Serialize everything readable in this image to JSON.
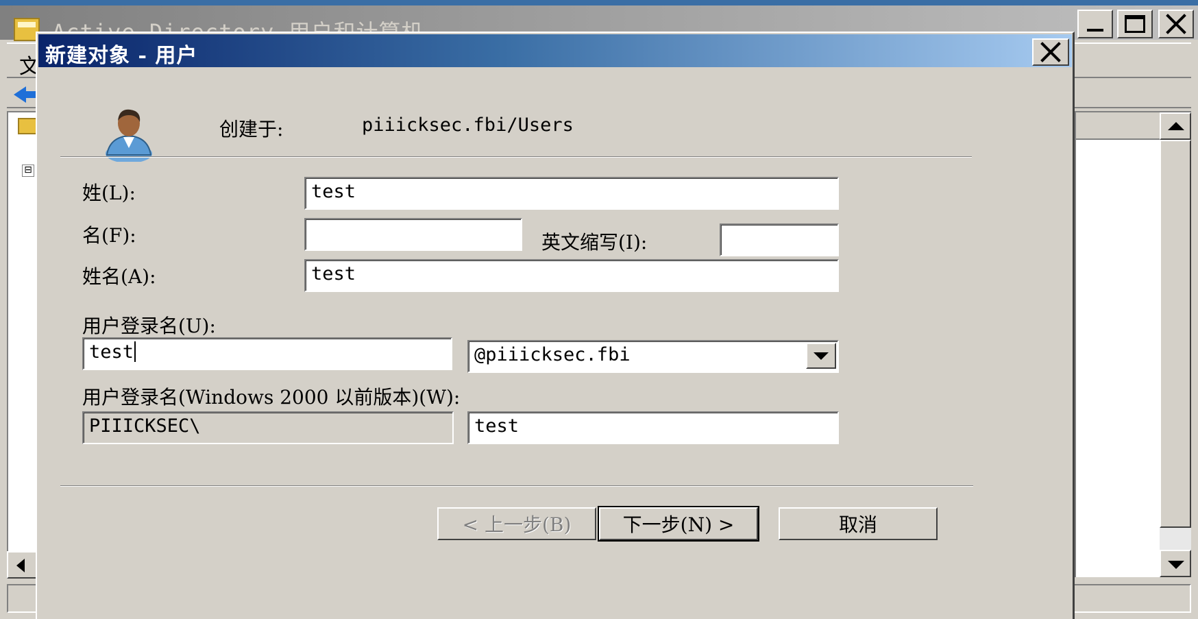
{
  "background_window": {
    "title": "Active Directory 用户和计算机",
    "menu_first_char": "文",
    "tree_toggle": "⊟"
  },
  "dialog": {
    "title": "新建对象 - 用户",
    "created_in_label": "创建于:",
    "created_in_value": "piiicksec.fbi/Users",
    "last_name_label": "姓(L):",
    "last_name_value": "test",
    "first_name_label": "名(F):",
    "first_name_value": "",
    "initials_label": "英文缩写(I):",
    "initials_value": "",
    "full_name_label": "姓名(A):",
    "full_name_value": "test",
    "logon_name_label": "用户登录名(U):",
    "logon_name_value": "test",
    "upn_suffix_selected": "@piiicksec.fbi",
    "pre2000_label": "用户登录名(Windows 2000 以前版本)(W):",
    "pre2000_domain": "PIIICKSEC\\",
    "pre2000_name": "test",
    "back_button": "< 上一步(B)",
    "next_button": "下一步(N) >",
    "cancel_button": "取消"
  },
  "icons": {
    "user": "user-icon",
    "close": "close-icon",
    "dropdown": "chevron-down-icon"
  },
  "colors": {
    "dialog_face": "#d4d0c8",
    "title_gradient_start": "#0a246a",
    "title_gradient_end": "#a6caf0"
  }
}
